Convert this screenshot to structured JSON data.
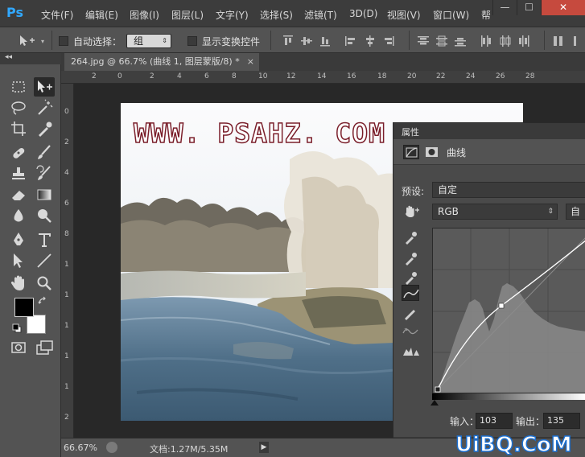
{
  "app": {
    "logo_text": "Ps"
  },
  "menu": {
    "items": [
      "文件(F)",
      "编辑(E)",
      "图像(I)",
      "图层(L)",
      "文字(Y)",
      "选择(S)",
      "滤镜(T)",
      "3D(D)",
      "视图(V)",
      "窗口(W)",
      "帮"
    ]
  },
  "window_controls": {
    "minimize": "—",
    "maximize": "☐",
    "close": "✕"
  },
  "options_bar": {
    "auto_select_label": "自动选择：",
    "auto_select_target": "组",
    "show_transform_label": "显示变换控件"
  },
  "document_tab": {
    "title": "264.jpg @ 66.7% (曲线 1, 图层蒙版/8) *",
    "close": "×"
  },
  "toolbox": {
    "collapse_glyph": "◂◂"
  },
  "ruler": {
    "top_ticks": [
      "2",
      "0",
      "2",
      "4",
      "6",
      "8",
      "10",
      "12",
      "14",
      "16",
      "18",
      "20",
      "22",
      "24",
      "26",
      "28"
    ],
    "left_ticks": [
      "0",
      "2",
      "4",
      "6",
      "8",
      "1",
      "1",
      "1",
      "1",
      "1",
      "2"
    ]
  },
  "image": {
    "watermark_text": "WWW. PSAHZ. COM"
  },
  "properties": {
    "panel_title": "属性",
    "adjustment_name": "曲线",
    "preset_label": "预设:",
    "preset_value": "自定",
    "channel_value": "RGB",
    "auto_button": "自",
    "input_label": "输入：",
    "input_value": "103",
    "output_label": "输出：",
    "output_value": "135"
  },
  "status": {
    "zoom": "66.67%",
    "doc_info": "文档:1.27M/5.35M",
    "arrow": "▶"
  },
  "site_watermark": "UiBQ.CoM"
}
